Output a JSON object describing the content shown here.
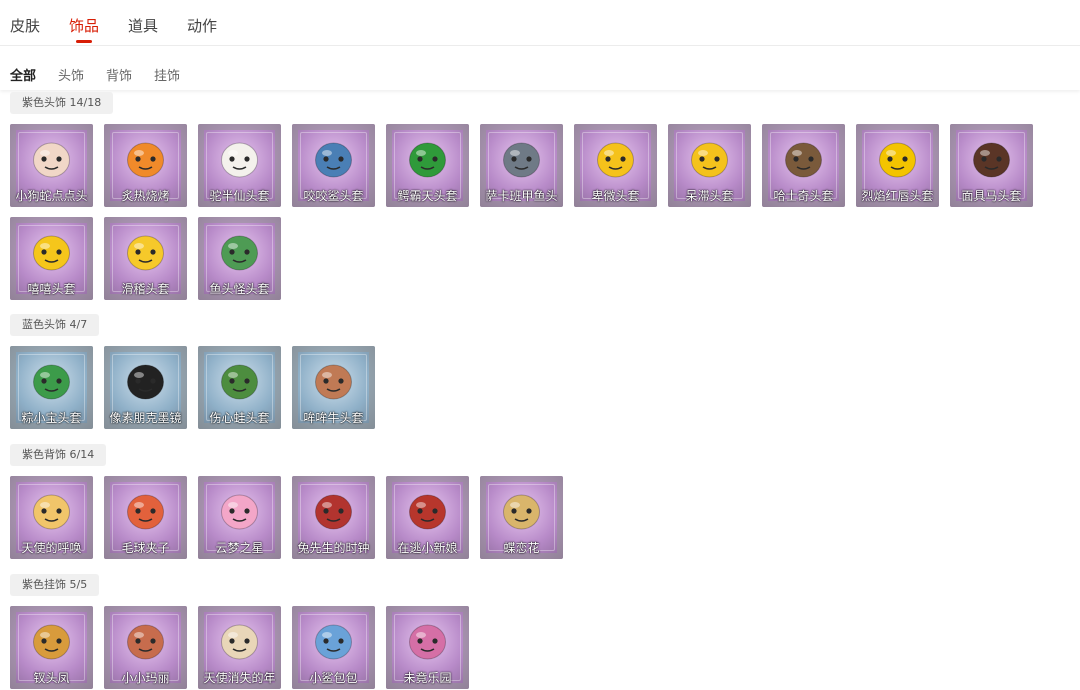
{
  "top_tabs": [
    {
      "label": "皮肤"
    },
    {
      "label": "饰品"
    },
    {
      "label": "道具"
    },
    {
      "label": "动作"
    }
  ],
  "sub_tabs": [
    {
      "label": "全部"
    },
    {
      "label": "头饰"
    },
    {
      "label": "背饰"
    },
    {
      "label": "挂饰"
    }
  ],
  "sections": [
    {
      "title": "紫色头饰 14/18",
      "theme": "purple",
      "items": [
        {
          "label": "小狗蛇点点头",
          "icon": "snake-dog-mask-icon",
          "color": "#f1d7c7"
        },
        {
          "label": "炙热烧烤",
          "icon": "bbq-mask-icon",
          "color": "#f08a2a"
        },
        {
          "label": "驼半仙头套",
          "icon": "camel-mask-icon",
          "color": "#f4f1ec"
        },
        {
          "label": "咬咬鲨头套",
          "icon": "shark-mask-icon",
          "color": "#4a7fb5"
        },
        {
          "label": "鳄霸天头套",
          "icon": "crocodile-mask-icon",
          "color": "#2f9a3a"
        },
        {
          "label": "萨卡班甲鱼头",
          "icon": "fish-mask-icon",
          "color": "#6f7a86"
        },
        {
          "label": "卑微头套",
          "icon": "humble-face-mask-icon",
          "color": "#f5c21b"
        },
        {
          "label": "呆滞头套",
          "icon": "blank-face-mask-icon",
          "color": "#f4c21c"
        },
        {
          "label": "哈士奇头套",
          "icon": "husky-mask-icon",
          "color": "#7a5a3b"
        },
        {
          "label": "烈焰红唇头套",
          "icon": "red-lips-mask-icon",
          "color": "#f3c400"
        },
        {
          "label": "面具马头套",
          "icon": "horse-mask-icon",
          "color": "#5a3526"
        },
        {
          "label": "嘻嘻头套",
          "icon": "grin-face-mask-icon",
          "color": "#f5c61b"
        },
        {
          "label": "滑稽头套",
          "icon": "funny-face-mask-icon",
          "color": "#f6c92a"
        },
        {
          "label": "鱼头怪头套",
          "icon": "fish-monster-mask-icon",
          "color": "#4e9b54"
        }
      ]
    },
    {
      "title": "蓝色头饰 4/7",
      "theme": "blue",
      "items": [
        {
          "label": "粽小宝头套",
          "icon": "zongzi-mask-icon",
          "color": "#3c9b4a"
        },
        {
          "label": "像素朋克墨镜",
          "icon": "pixel-sunglasses-icon",
          "color": "#222222"
        },
        {
          "label": "伤心蛙头套",
          "icon": "sad-frog-mask-icon",
          "color": "#4d8d3f"
        },
        {
          "label": "哞哞牛头套",
          "icon": "cow-mask-icon",
          "color": "#c07a55"
        }
      ]
    },
    {
      "title": "紫色背饰 6/14",
      "theme": "purple",
      "items": [
        {
          "label": "天使的呼唤",
          "icon": "angel-back-icon",
          "color": "#f1c56a"
        },
        {
          "label": "毛球夹子",
          "icon": "furball-clip-icon",
          "color": "#e2613c"
        },
        {
          "label": "云梦之星",
          "icon": "cloud-star-icon",
          "color": "#f3a6c8"
        },
        {
          "label": "兔先生的时钟",
          "icon": "rabbit-clock-icon",
          "color": "#b2342f"
        },
        {
          "label": "在逃小新娘",
          "icon": "runaway-bride-icon",
          "color": "#b7362c"
        },
        {
          "label": "蝶恋花",
          "icon": "butterfly-flower-icon",
          "color": "#d9b56b"
        }
      ]
    },
    {
      "title": "紫色挂饰 5/5",
      "theme": "purple",
      "items": [
        {
          "label": "钗头凤",
          "icon": "phoenix-hairpin-icon",
          "color": "#d89b3c"
        },
        {
          "label": "小小玛丽",
          "icon": "little-mary-icon",
          "color": "#c76c4d"
        },
        {
          "label": "天使消失的年",
          "icon": "vanished-angel-icon",
          "color": "#e9d6b8"
        },
        {
          "label": "小鲨包包",
          "icon": "shark-bag-icon",
          "color": "#6aa2d8"
        },
        {
          "label": "未竟乐园",
          "icon": "unfinished-park-icon",
          "color": "#d56fa6"
        }
      ]
    }
  ]
}
